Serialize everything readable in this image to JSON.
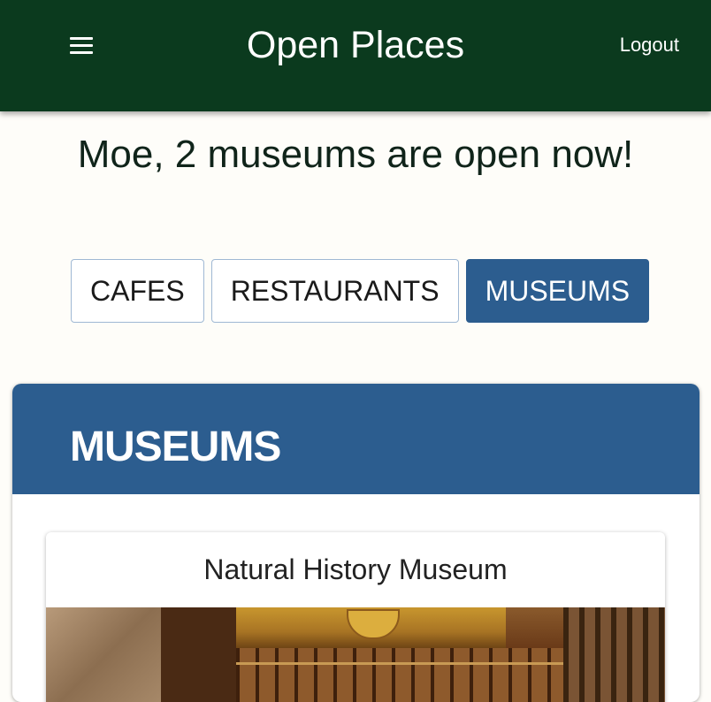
{
  "app_bar": {
    "title": "Open Places",
    "menu_icon": "hamburger-menu-icon",
    "logout_label": "Logout",
    "background_color": "#0b3a1e"
  },
  "greeting": "Moe, 2 museums are open now!",
  "tabs": [
    {
      "label": "CAFES",
      "active": false
    },
    {
      "label": "RESTAURANTS",
      "active": false
    },
    {
      "label": "MUSEUMS",
      "active": true
    }
  ],
  "accent_color": "#2c5d8f",
  "panel": {
    "title": "MUSEUMS",
    "places": [
      {
        "name": "Natural History Museum"
      }
    ]
  }
}
